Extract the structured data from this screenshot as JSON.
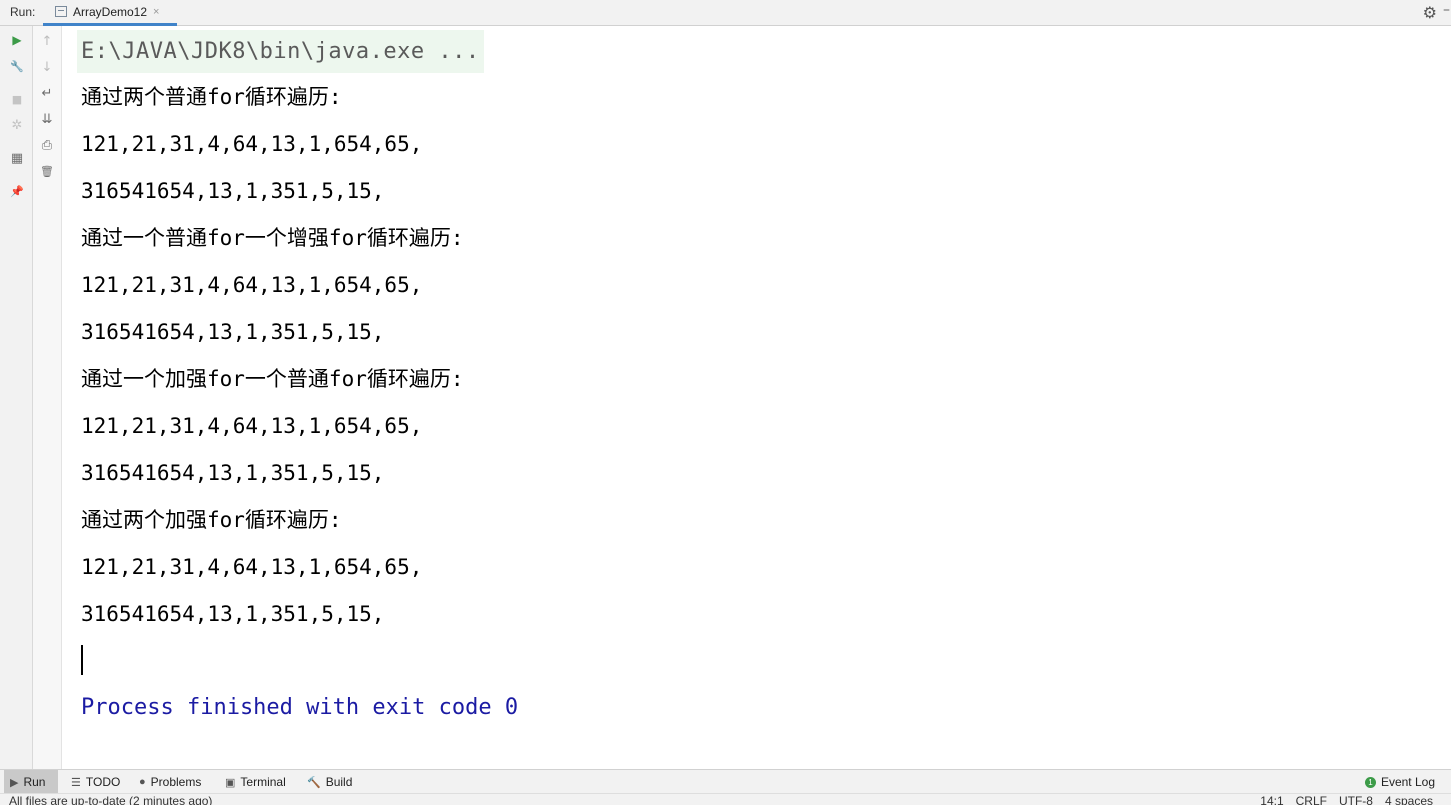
{
  "topbar": {
    "run_label": "Run:",
    "tab_title": "ArrayDemo12",
    "tab_close": "×",
    "settings_glyph": "⚙",
    "minimize_glyph": "–"
  },
  "toolbar_left": [
    {
      "name": "rerun-icon",
      "glyph": "▶",
      "color": "#3c9b48"
    },
    {
      "name": "wrench-icon",
      "glyph": "🔧"
    },
    {
      "name": "stop-icon",
      "glyph": "■"
    },
    {
      "name": "debug-off-icon",
      "glyph": "✲"
    },
    {
      "name": "layout-icon",
      "glyph": "▦"
    },
    {
      "name": "pin-icon",
      "glyph": "📌"
    }
  ],
  "toolbar_right": [
    {
      "name": "up-arrow-icon",
      "glyph": "↑"
    },
    {
      "name": "down-arrow-icon",
      "glyph": "↓"
    },
    {
      "name": "soft-wrap-icon",
      "glyph": "↵"
    },
    {
      "name": "scroll-to-end-icon",
      "glyph": "⇊"
    },
    {
      "name": "print-icon",
      "glyph": "⎙"
    },
    {
      "name": "trash-icon",
      "glyph": "🗑"
    }
  ],
  "console": {
    "command": "E:\\JAVA\\JDK8\\bin\\java.exe ...",
    "lines": [
      "通过两个普通for循环遍历:",
      "121,21,31,4,64,13,1,654,65,",
      "316541654,13,1,351,5,15,",
      "通过一个普通for一个增强for循环遍历:",
      "121,21,31,4,64,13,1,654,65,",
      "316541654,13,1,351,5,15,",
      "通过一个加强for一个普通for循环遍历:",
      "121,21,31,4,64,13,1,654,65,",
      "316541654,13,1,351,5,15,",
      "通过两个加强for循环遍历:",
      "121,21,31,4,64,13,1,654,65,",
      "316541654,13,1,351,5,15,"
    ],
    "process_finished": "Process finished with exit code 0"
  },
  "bottombar": {
    "items": [
      {
        "label": "Run",
        "icon": "▶"
      },
      {
        "label": "TODO",
        "icon": "☰"
      },
      {
        "label": "Problems",
        "icon": "●"
      },
      {
        "label": "Terminal",
        "icon": "▣"
      },
      {
        "label": "Build",
        "icon": "🔨"
      }
    ],
    "event_log": "Event Log",
    "event_count": "1"
  },
  "statusbar": {
    "message": "All files are up-to-date (2 minutes ago)",
    "position": "14:1",
    "line_sep": "CRLF",
    "encoding": "UTF-8",
    "indent": "4 spaces"
  },
  "colors": {
    "process_text": "#1b1ba3",
    "command_bg": "#edf7ee",
    "run_green": "#3c9b48",
    "tab_underline": "#4083c9"
  }
}
